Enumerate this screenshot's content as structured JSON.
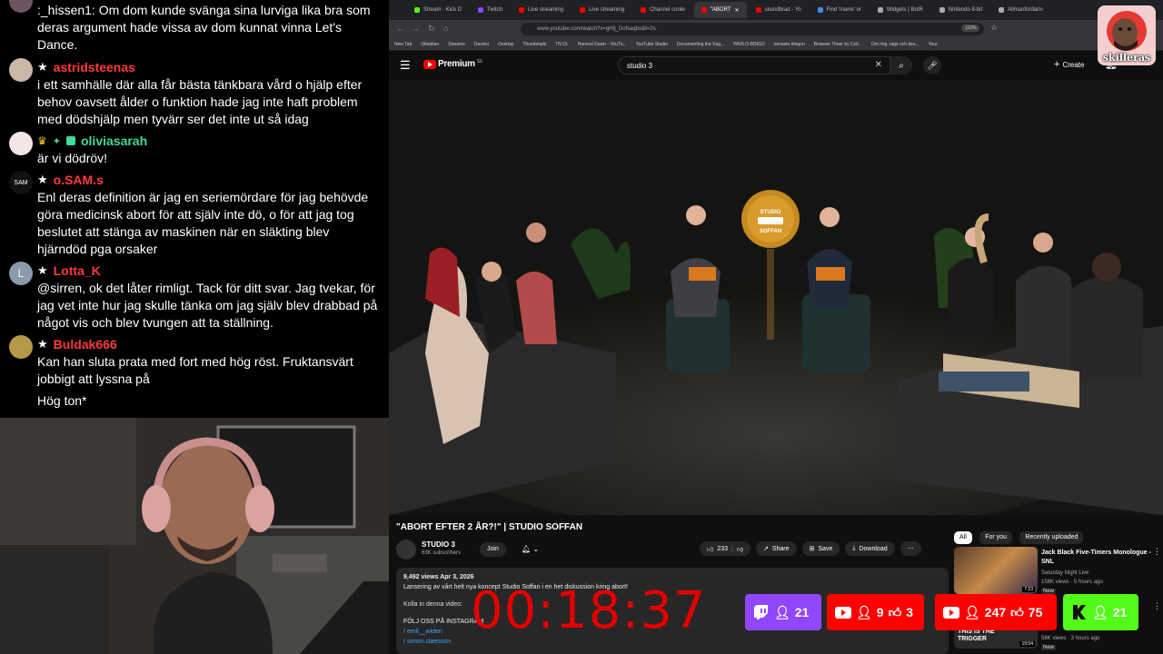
{
  "chat": {
    "messages": [
      {
        "user": "",
        "text": ":_hissen1: Om dom kunde svänga sina lurviga lika bra som deras argument hade vissa av dom kunnat vinna Let's Dance."
      },
      {
        "user": "astridsteenas",
        "color": "#ff3b3b",
        "text": "i ett samhälle där alla får bästa tänkbara vård o hjälp efter behov oavsett ålder o funktion hade jag inte haft problem med dödshjälp men tyvärr ser det inte ut så idag"
      },
      {
        "user": "oliviasarah",
        "color": "#3ddc97",
        "text": "är vi dödröv!"
      },
      {
        "user": "o.SAM.s",
        "color": "#ff3b3b",
        "avatar_text": "SAM",
        "text": "Enl deras definition är jag en seriemördare för jag behövde göra medicinsk abort för att själv inte dö, o för att jag tog beslutet att stänga av maskinen när en släkting blev hjärndöd pga orsaker"
      },
      {
        "user": "Lotta_K",
        "color": "#ff3b3b",
        "avatar_text": "L",
        "text": "@sirren, ok det låter rimligt. Tack för ditt svar. Jag tvekar, för jag vet inte hur jag skulle tänka om jag själv blev drabbad på något vis och blev tvungen att ta ställning."
      },
      {
        "user": "Buldak666",
        "color": "#ff3b3b",
        "text": "Kan han sluta prata med fort med hög röst. Fruktansvärt jobbigt att lyssna på"
      },
      {
        "user": "",
        "text": "Hög ton*"
      }
    ]
  },
  "browser": {
    "tabs": [
      "Stream - Kick D",
      "Twitch",
      "Live streaming",
      "Live streaming",
      "Channel conte",
      "\"ABORT",
      "skundbrad - Yo",
      "Find 'marre' or",
      "Widgets | BotR",
      "Nintendo 8-bit",
      "Allmanfordarin"
    ],
    "url": "www.youtube.com/watch?v=gHtj_DoNaqbo&t=2s",
    "zoom": "110%",
    "bookmarks": [
      "New Tab",
      "Obsidian",
      "Streams",
      "Davinci",
      "Overlay",
      "Thumbnails",
      "TN DL",
      "Harvest Dawn - YouTu...",
      "YouTube Studio",
      "Documenting the Sag...",
      "PAOLO-BINGO",
      "senaste bingon",
      "Browser Timer by Coll...",
      "Om mig, tags och des...",
      "Your"
    ]
  },
  "youtube": {
    "logo_text": "Premium",
    "logo_sup": "SE",
    "search_value": "studio 3",
    "create_label": "Create",
    "video": {
      "studio_sign_top": "STUDIO",
      "studio_sign_bottom": "SOFFAN"
    },
    "title": "\"ABORT EFTER 2 ÅR?!\" | STUDIO SOFFAN",
    "channel": "STUDIO 3",
    "subscribers": "63K subscribers",
    "join_label": "Join",
    "likes": "233",
    "share_label": "Share",
    "save_label": "Save",
    "download_label": "Download",
    "views": "9,492 views  Apr 3, 2026",
    "description_line1": "Lansering av vårt helt nya koncept Studio Soffan i en het diskussion kring abort!",
    "description_line2": "Kolla in denna video:",
    "description_line3": "FÖLJ OSS PÅ INSTAGRAM",
    "description_line4": "/ emil__widen",
    "description_line5": "/ simon.claesson",
    "chips": [
      "All",
      "For you",
      "Recently uploaded"
    ],
    "recommendations": [
      {
        "title": "Jack Black Five-Timers Monologue - SNL",
        "channel": "Saturday Night Live",
        "meta": "158K views · 5 hours ago",
        "badge": "New",
        "duration": "7:23",
        "thumb_text": ""
      },
      {
        "title": "",
        "channel": "",
        "meta": "58K views · 3 hours ago",
        "badge": "New",
        "duration": "19:54",
        "thumb_text": "THIS IS THE TRIGGER"
      }
    ]
  },
  "overlay": {
    "timer": "00:18:37",
    "stats": [
      {
        "platform": "twitch",
        "color": "#9146ff",
        "viewers": "21"
      },
      {
        "platform": "youtube",
        "color": "#ff0000",
        "viewers": "9",
        "likes": "3"
      },
      {
        "platform": "youtube",
        "color": "#ff0000",
        "viewers": "247",
        "likes": "75"
      },
      {
        "platform": "kick",
        "color": "#53fc18",
        "viewers": "21"
      }
    ],
    "badge_name": "skilleras"
  }
}
